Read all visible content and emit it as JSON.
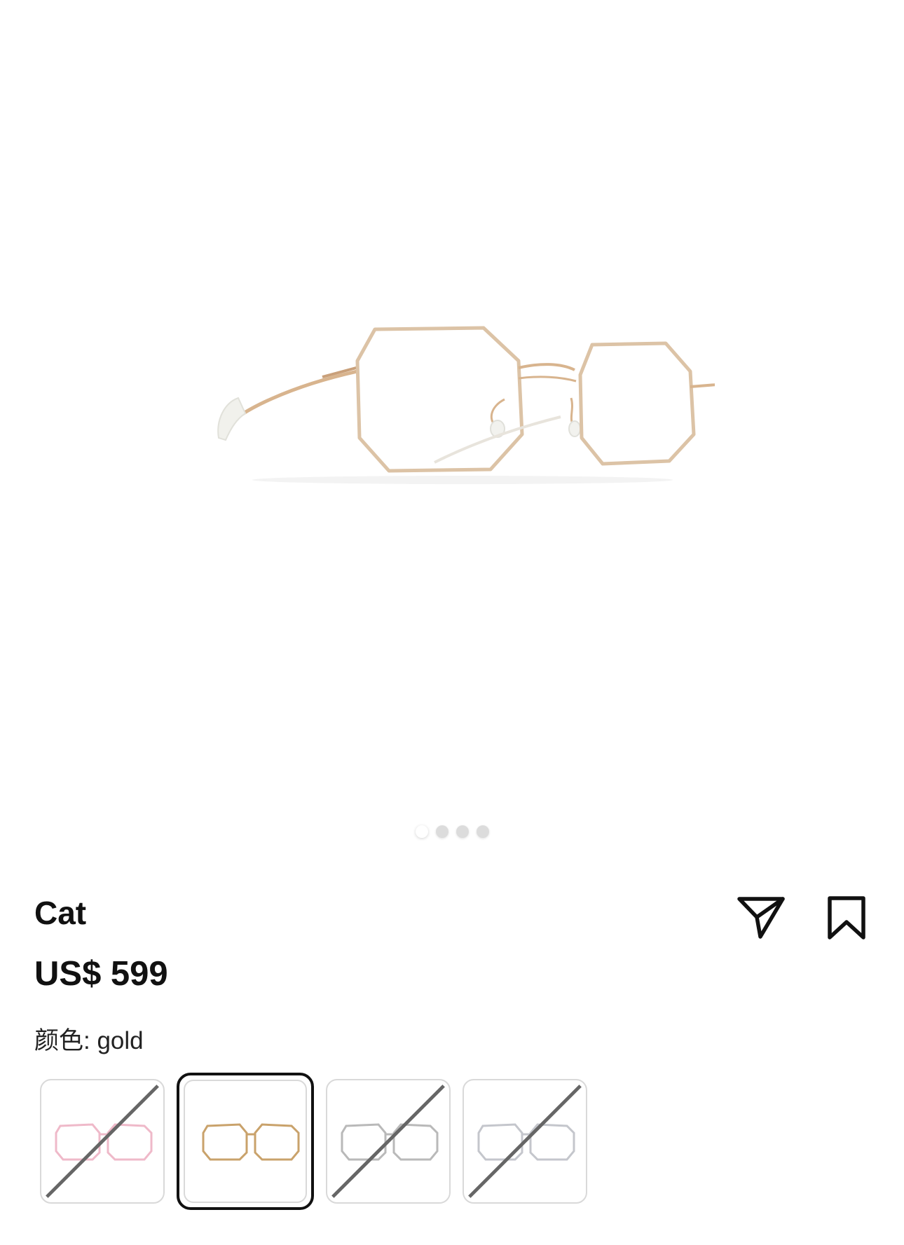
{
  "product": {
    "name": "Cat",
    "price": "US$ 599"
  },
  "gallery": {
    "image_count": 4,
    "active_index": 0
  },
  "color": {
    "label": "颜色: gold",
    "selected": "gold"
  },
  "swatches": [
    {
      "color": "#efb9c9",
      "available": false
    },
    {
      "color": "#c9a26b",
      "available": true,
      "selected": true
    },
    {
      "color": "#b9b9b9",
      "available": false
    },
    {
      "color": "#c4c6cc",
      "available": false
    }
  ],
  "icons": {
    "share": "paper-plane-icon",
    "bookmark": "bookmark-icon"
  },
  "colors": {
    "frame_gold": "#d8b48e",
    "text": "#111111",
    "swatch_border": "#d9d9d9"
  }
}
